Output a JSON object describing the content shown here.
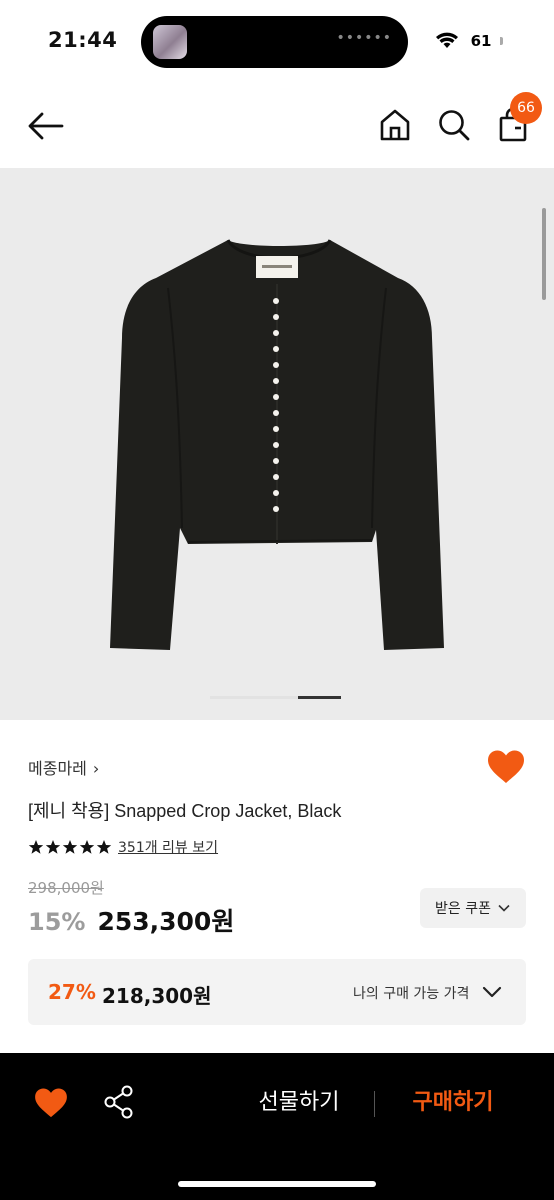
{
  "status_bar": {
    "time": "21:44",
    "battery": "61"
  },
  "nav": {
    "cart_count": "66"
  },
  "product": {
    "brand": "메종마레",
    "title": "[제니 착용] Snapped Crop Jacket, Black",
    "rating": 5,
    "review_link": "351개 리뷰 보기",
    "original_price": "298,000원",
    "discount_rate": "15%",
    "sale_price": "253,300원",
    "coupon_label": "받은 쿠폰",
    "my_price": {
      "rate": "27%",
      "price": "218,300원",
      "label": "나의 구매 가능 가격"
    }
  },
  "bottom_bar": {
    "gift_label": "선물하기",
    "buy_label": "구매하기"
  },
  "colors": {
    "accent": "#f25a13",
    "image_bg": "#ebebeb",
    "jacket": "#1f1f1c"
  },
  "icons": [
    "back-arrow-icon",
    "home-icon",
    "search-icon",
    "shopping-bag-icon",
    "heart-icon",
    "star-icon",
    "share-icon",
    "chevron-down-icon",
    "wifi-icon"
  ]
}
